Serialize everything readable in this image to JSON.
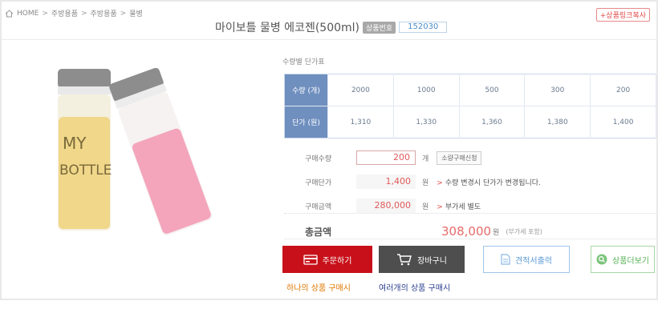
{
  "breadcrumb": {
    "home": "HOME",
    "items": [
      "주방용품",
      "주방용품",
      "물병"
    ]
  },
  "header": {
    "title": "마이보틀 물병 에코젠(500ml)",
    "code_label": "상품번호",
    "code_value": "152030",
    "link_copy": "+상품링크복사"
  },
  "image": {
    "alt": "MY BOTTLE"
  },
  "price_table": {
    "title": "수량별 단가표",
    "qty_header": "수량 (개)",
    "price_header": "단가 (원)",
    "quantities": [
      "2000",
      "1000",
      "500",
      "300",
      "200"
    ],
    "prices": [
      "1,310",
      "1,330",
      "1,360",
      "1,380",
      "1,400"
    ]
  },
  "order": {
    "qty_label": "구매수량",
    "qty_value": "200",
    "qty_unit": "개",
    "small_qty_button": "소량구매신청",
    "unit_price_label": "구매단가",
    "unit_price_value": "1,400",
    "unit_price_unit": "원",
    "unit_price_note": "수량 변경시 단가가 변경됩니다.",
    "amount_label": "구매금액",
    "amount_value": "280,000",
    "amount_unit": "원",
    "amount_note": "부가세 별도"
  },
  "total": {
    "label": "총금액",
    "value": "308,000",
    "unit": "원",
    "vat_note": "(부가세 포함)"
  },
  "buttons": {
    "order": "주문하기",
    "cart": "장바구니",
    "estimate": "견적서출력",
    "more": "상품더보기"
  },
  "captions": {
    "single": "하나의 상품 구매시",
    "multi": "여러개의 상품 구매시"
  },
  "colors": {
    "accent": "#c8101a",
    "table_header": "#6f8fbf",
    "price_text": "#e05a5a"
  }
}
